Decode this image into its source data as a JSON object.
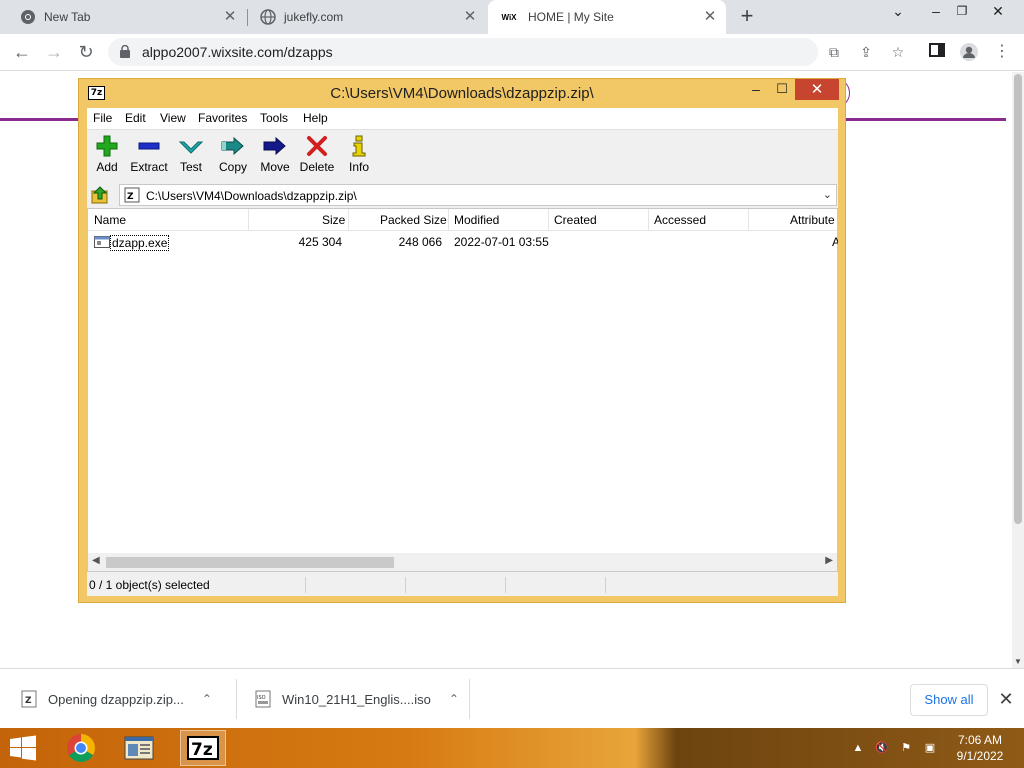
{
  "browser": {
    "tabs": [
      {
        "title": "New Tab"
      },
      {
        "title": "jukefly.com"
      },
      {
        "title": "HOME | My Site",
        "favicon_text": "WiX"
      }
    ],
    "url": "alppo2007.wixsite.com/dzapps"
  },
  "zip_window": {
    "title": "C:\\Users\\VM4\\Downloads\\dzappzip.zip\\",
    "logo_text": "7z",
    "menu": [
      "File",
      "Edit",
      "View",
      "Favorites",
      "Tools",
      "Help"
    ],
    "toolbar": [
      {
        "label": "Add",
        "icon": "plus-icon",
        "color": "#22a81e"
      },
      {
        "label": "Extract",
        "icon": "minus-icon",
        "color": "#1e2fc8"
      },
      {
        "label": "Test",
        "icon": "check-down-icon",
        "color": "#20a8a8"
      },
      {
        "label": "Copy",
        "icon": "double-arrow-icon",
        "color": "#1b8a86"
      },
      {
        "label": "Move",
        "icon": "arrow-right-icon",
        "color": "#141a8c"
      },
      {
        "label": "Delete",
        "icon": "x-icon",
        "color": "#d21f1f"
      },
      {
        "label": "Info",
        "icon": "info-icon",
        "color": "#c8b400"
      }
    ],
    "path": "C:\\Users\\VM4\\Downloads\\dzappzip.zip\\",
    "columns": [
      "Name",
      "Size",
      "Packed Size",
      "Modified",
      "Created",
      "Accessed",
      "Attribute"
    ],
    "rows": [
      {
        "name": "dzapp.exe",
        "size": "425 304",
        "packed_size": "248 066",
        "modified": "2022-07-01 03:55",
        "created": "",
        "accessed": "",
        "attributes": "A"
      }
    ],
    "status": "0 / 1 object(s) selected"
  },
  "downloads": {
    "items": [
      {
        "label": "Opening dzappzip.zip..."
      },
      {
        "label": "Win10_21H1_Englis....iso"
      }
    ],
    "show_all": "Show all"
  },
  "taskbar": {
    "time": "7:06 AM",
    "date": "9/1/2022"
  }
}
